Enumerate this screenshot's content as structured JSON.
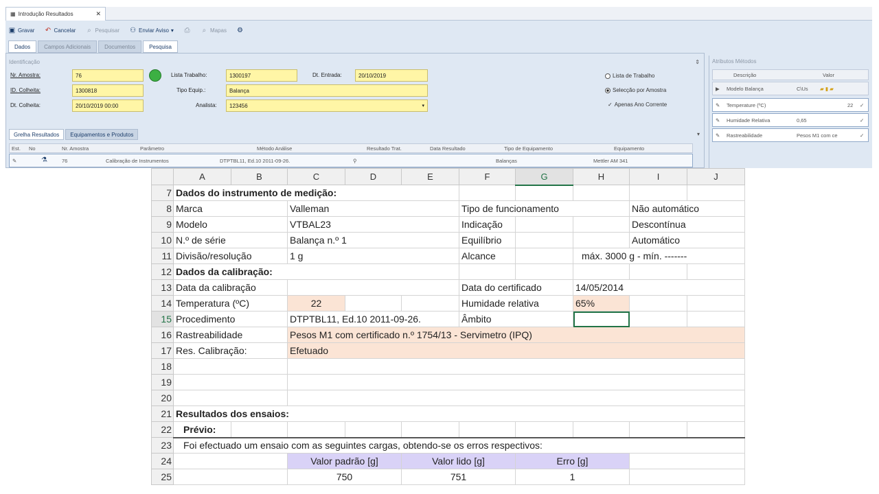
{
  "app": {
    "doc_tab": "Introdução Resultados",
    "toolbar": {
      "save": "Gravar",
      "cancel": "Cancelar",
      "search": "Pesquisar",
      "send_alert": "Enviar Aviso",
      "maps": "Mapas"
    },
    "subtabs": [
      "Dados",
      "Campos Adicionais",
      "Documentos",
      "Pesquisa"
    ],
    "group_title": "Identificação",
    "fields": {
      "nr_amostra_label": "Nr. Amostra:",
      "nr_amostra": "76",
      "id_colheita_label": "ID. Colheita:",
      "id_colheita": "1300818",
      "dt_colheita_label": "Dt. Colheita:",
      "dt_colheita": "20/10/2019 00:00",
      "lista_trabalho_label": "Lista Trabalho:",
      "lista_trabalho": "1300197",
      "dt_entrada_label": "Dt. Entrada:",
      "dt_entrada": "20/10/2019",
      "tipo_equip_label": "Tipo Equip.:",
      "tipo_equip": "Balança",
      "analista_label": "Analista:",
      "analista": "123456"
    },
    "options": {
      "lista_trabalho": "Lista de Trabalho",
      "seleccao_amostra": "Selecção por Amostra",
      "apenas_ano": "Apenas Ano Corrente"
    },
    "grid_tabs": [
      "Grelha Resultados",
      "Equipamentos e Produtos"
    ],
    "grid_columns": [
      "Est.",
      "No",
      "Nr. Amostra",
      "Parâmetro",
      "Método Análise",
      "Resultado Trat.",
      "Data Resultado",
      "Tipo de Equipamento",
      "Equipamento"
    ],
    "grid_row": {
      "nr_amostra": "76",
      "parametro": "Calibração de Instrumentos",
      "metodo": "DTPTBL11, Ed.10 2011-09-26.",
      "tipo_equip": "Balanças",
      "equipamento": "Mettler AM 341"
    },
    "attr_panel": {
      "title": "Atributos Métodos",
      "col_desc": "Descrição",
      "col_valor": "Valor",
      "rows": [
        {
          "desc": "Modelo Balança",
          "valor": "C\\Us"
        },
        {
          "desc": "Temperature (ºC)",
          "valor": "22"
        },
        {
          "desc": "Humidade Relativa",
          "valor": "0,65"
        },
        {
          "desc": "Rastreabilidade",
          "valor": "Pesos M1 com ce"
        }
      ]
    }
  },
  "sheet": {
    "columns": [
      "A",
      "B",
      "C",
      "D",
      "E",
      "F",
      "G",
      "H",
      "I",
      "J"
    ],
    "rows": {
      "r7": {
        "num": "7",
        "a": "Dados do instrumento de medição:"
      },
      "r8": {
        "num": "8",
        "a": "Marca",
        "c": "Valleman",
        "f": "Tipo de funcionamento",
        "i": "Não automático"
      },
      "r9": {
        "num": "9",
        "a": "Modelo",
        "c": "VTBAL23",
        "f": "Indicação",
        "i": "Descontínua"
      },
      "r10": {
        "num": "10",
        "a": "N.º de série",
        "c": "Balança n.º 1",
        "f": "Equilíbrio",
        "i": "Automático"
      },
      "r11": {
        "num": "11",
        "a": "Divisão/resolução",
        "c": "1 g",
        "f": "Alcance",
        "h": "máx. 3000 g - mín. -------"
      },
      "r12": {
        "num": "12",
        "a": "Dados da calibração:"
      },
      "r13": {
        "num": "13",
        "a": "Data da calibração",
        "f": "Data do certificado",
        "g": "14/05/2014"
      },
      "r14": {
        "num": "14",
        "a": "Temperatura (ºC)",
        "c": "22",
        "f": "Humidade relativa",
        "h": "65%"
      },
      "r15": {
        "num": "15",
        "a": "Procedimento",
        "c": "DTPTBL11, Ed.10 2011-09-26.",
        "f": "Âmbito"
      },
      "r16": {
        "num": "16",
        "a": "Rastreabilidade",
        "c": "Pesos M1 com certificado n.º 1754/13 - Servimetro (IPQ)"
      },
      "r17": {
        "num": "17",
        "a": "Res. Calibração:",
        "c": "Efetuado"
      },
      "r18": {
        "num": "18"
      },
      "r19": {
        "num": "19"
      },
      "r20": {
        "num": "20"
      },
      "r21": {
        "num": "21",
        "a": "Resultados dos ensaios:"
      },
      "r22": {
        "num": "22",
        "a": "Prévio:"
      },
      "r23": {
        "num": "23",
        "a": "Foi efectuado um ensaio com as seguintes cargas, obtendo-se os erros respectivos:"
      },
      "r24": {
        "num": "24",
        "c": "Valor padrão [g]",
        "e": "Valor lido [g]",
        "g": "Erro [g]"
      },
      "r25": {
        "num": "25",
        "c": "750",
        "e": "751",
        "g": "1"
      }
    }
  }
}
